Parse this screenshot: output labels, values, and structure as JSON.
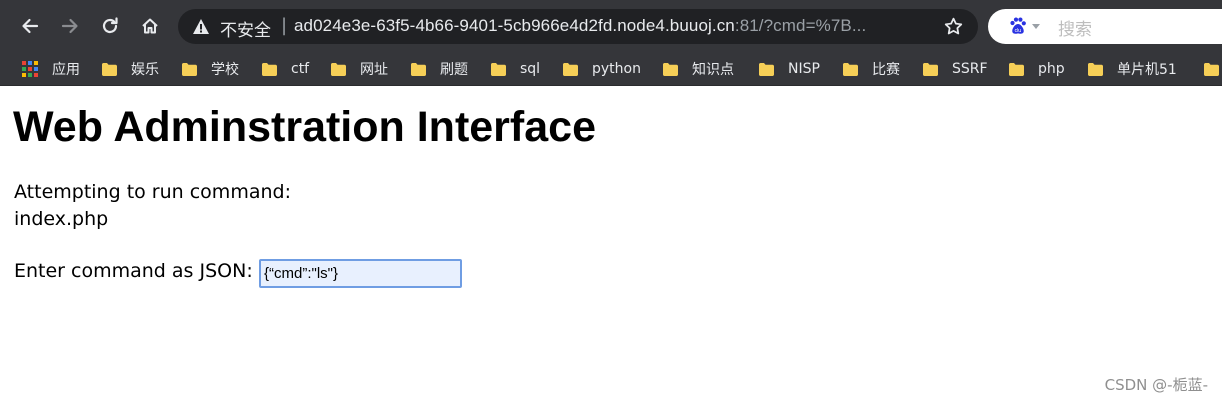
{
  "browser": {
    "security_label": "不安全",
    "url_separator": "|",
    "url_host": "ad024e3e-63f5-4b66-9401-5cb966e4d2fd.node4.buuoj.cn",
    "url_rest": ":81/?cmd=%7B...",
    "search_placeholder": "搜索",
    "accent_color": "#35363a",
    "icons": [
      "back-icon",
      "forward-icon",
      "reload-icon",
      "home-icon",
      "warning-icon",
      "star-icon",
      "baidu-icon"
    ]
  },
  "bookmarks": [
    {
      "label": "应用",
      "icon": "apps-icon"
    },
    {
      "label": "娱乐",
      "icon": "folder-icon"
    },
    {
      "label": "学校",
      "icon": "folder-icon"
    },
    {
      "label": "ctf",
      "icon": "folder-icon"
    },
    {
      "label": "网址",
      "icon": "folder-icon"
    },
    {
      "label": "刷题",
      "icon": "folder-icon"
    },
    {
      "label": "sql",
      "icon": "folder-icon"
    },
    {
      "label": "python",
      "icon": "folder-icon"
    },
    {
      "label": "知识点",
      "icon": "folder-icon"
    },
    {
      "label": "NISP",
      "icon": "folder-icon"
    },
    {
      "label": "比赛",
      "icon": "folder-icon"
    },
    {
      "label": "SSRF",
      "icon": "folder-icon"
    },
    {
      "label": "php",
      "icon": "folder-icon"
    },
    {
      "label": "单片机51",
      "icon": "folder-icon"
    }
  ],
  "page": {
    "title": "Web Adminstration Interface",
    "attempt_text": "Attempting to run command:",
    "command_output": "index.php",
    "prompt_label": "Enter command as JSON:",
    "json_input_value": "{“cmd”:\"ls\"}"
  },
  "watermark": "CSDN @-栀蓝-"
}
